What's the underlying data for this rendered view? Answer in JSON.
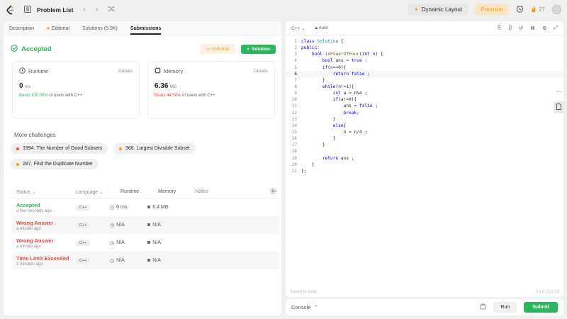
{
  "colors": {
    "accent_green": "#2db55d",
    "accent_red": "#ef4743",
    "accent_orange": "#f59e0b"
  },
  "topbar": {
    "title": "Problem List",
    "dynamic_layout": "Dynamic Layout",
    "premium": "Premium",
    "streak": "27"
  },
  "tabs": [
    {
      "label": "Description"
    },
    {
      "label": "Editorial"
    },
    {
      "label": "Solutions (5.9K)"
    },
    {
      "label": "Submissions"
    }
  ],
  "result": {
    "status": "Accepted",
    "editorial_btn": "Editorial",
    "solution_btn": "Solution"
  },
  "runtime": {
    "label": "Runtime",
    "details": "Details",
    "value": "0",
    "unit": "ms",
    "beats_pct": "Beats 100.00%",
    "beats_rest": "of users with C++"
  },
  "memory": {
    "label": "Memory",
    "details": "Details",
    "value": "6.36",
    "unit": "MB",
    "beats_pct": "Beats 44.50%",
    "beats_rest": "of users with C++"
  },
  "more": {
    "title": "More challenges",
    "items": [
      {
        "label": "1994. The Number of Good Subsets",
        "color": "#ef4743"
      },
      {
        "label": "368. Largest Divisible Subset",
        "color": "#f59e0b"
      },
      {
        "label": "287. Find the Duplicate Number",
        "color": "#f59e0b"
      }
    ]
  },
  "table": {
    "headers": {
      "status": "Status",
      "language": "Language",
      "runtime": "Runtime",
      "memory": "Memory",
      "notes": "Notes"
    },
    "rows": [
      {
        "status": "Accepted",
        "time": "a few seconds ago",
        "lang": "C++",
        "runtime": "0 ms",
        "memory": "6.4 MB"
      },
      {
        "status": "Wrong Answer",
        "time": "a minute ago",
        "lang": "C++",
        "runtime": "N/A",
        "memory": "N/A"
      },
      {
        "status": "Wrong Answer",
        "time": "a minute ago",
        "lang": "C++",
        "runtime": "N/A",
        "memory": "N/A"
      },
      {
        "status": "Time Limit Exceeded",
        "time": "3 minutes ago",
        "lang": "C++",
        "runtime": "N/A",
        "memory": "N/A"
      }
    ]
  },
  "editor": {
    "language": "C++",
    "mode": "Auto",
    "saved": "Saved to local",
    "position": "Ln 6, Col 23",
    "current_line": 6,
    "lines": [
      "class Solution {",
      "public:",
      "    bool isPowerOfFour(int n) {",
      "        bool ans = true ;",
      "        if(n==0){",
      "            return false ;",
      "        }",
      "        while(n!=1){",
      "            int a = n%4 ;",
      "            if(a!=0){",
      "                ans = false ;",
      "                break;",
      "            }",
      "            else{",
      "                n = n/4 ;",
      "            }",
      "        }",
      "",
      "        return ans ;",
      "    }",
      "};"
    ]
  },
  "console": {
    "label": "Console",
    "run": "Run",
    "submit": "Submit"
  }
}
